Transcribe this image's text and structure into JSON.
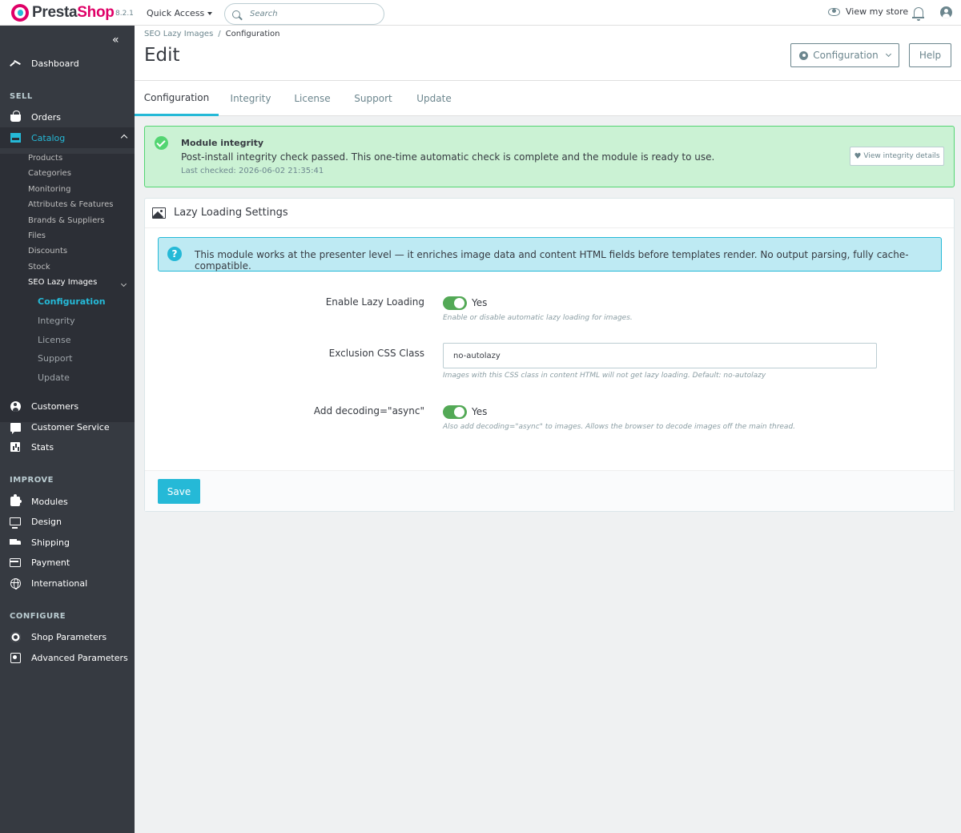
{
  "header": {
    "brand_presta": "Presta",
    "brand_shop": "Shop",
    "version": "8.2.1",
    "quick_access": "Quick Access",
    "search_placeholder": "Search",
    "view_store": "View my store"
  },
  "sidebar": {
    "collapse": "«",
    "dashboard": "Dashboard",
    "sections": {
      "sell": "SELL",
      "improve": "IMPROVE",
      "configure": "CONFIGURE"
    },
    "sell_items": [
      "Orders",
      "Catalog"
    ],
    "catalog_sub": [
      "Products",
      "Categories",
      "Monitoring",
      "Attributes & Features",
      "Brands & Suppliers",
      "Files",
      "Discounts",
      "Stock",
      "SEO Lazy Images"
    ],
    "module_sub": [
      "Configuration",
      "Integrity",
      "License",
      "Support",
      "Update"
    ],
    "sell_after": [
      "Customers",
      "Customer Service",
      "Stats"
    ],
    "improve_items": [
      "Modules",
      "Design",
      "Shipping",
      "Payment",
      "International"
    ],
    "configure_items": [
      "Shop Parameters",
      "Advanced Parameters"
    ]
  },
  "page": {
    "breadcrumb": [
      "SEO Lazy Images",
      "/",
      "Configuration"
    ],
    "title": "Edit",
    "configuration_button": "Configuration",
    "help_button": "Help"
  },
  "tabs": [
    "Configuration",
    "Integrity",
    "License",
    "Support",
    "Update"
  ],
  "integrity_alert": {
    "title": "Module integrity",
    "message": "Post-install integrity check passed. This one-time automatic check is complete and the module is ready to use.",
    "last_checked": "Last checked: 2026-06-02 21:35:41",
    "details_button": "View integrity details"
  },
  "panel": {
    "title": "Lazy Loading Settings",
    "info": "This module works at the presenter level — it enriches image data and content HTML fields before templates render. No output parsing, fully cache-compatible.",
    "fields": {
      "lazy": {
        "label": "Enable Lazy Loading",
        "value": "Yes",
        "help": "Enable or disable automatic lazy loading for images."
      },
      "exclusion": {
        "label": "Exclusion CSS Class",
        "value": "no-autolazy",
        "help": "Images with this CSS class in content HTML will not get lazy loading. Default: no-autolazy"
      },
      "decoding": {
        "label": "Add decoding=\"async\"",
        "value": "Yes",
        "help": "Also add decoding=\"async\" to images. Allows the browser to decode images off the main thread."
      }
    },
    "save_button": "Save"
  },
  "colors": {
    "brand": "#df0067",
    "accent": "#25b9d7",
    "sidebar": "#363a41",
    "success": "#53d572",
    "toggle_on": "#53a956"
  }
}
